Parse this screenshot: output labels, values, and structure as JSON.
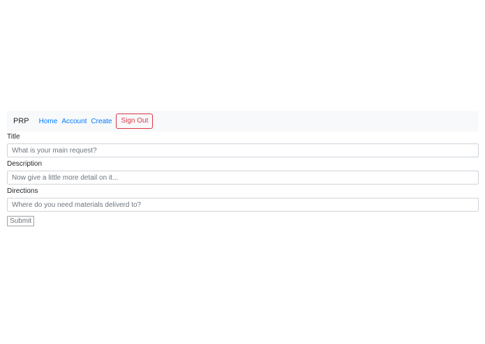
{
  "nav": {
    "brand": "PRP",
    "links": [
      "Home",
      "Account",
      "Create"
    ],
    "signout": "Sign Out"
  },
  "form": {
    "title_label": "Title",
    "title_placeholder": "What is your main request?",
    "description_label": "Description",
    "description_placeholder": "Now give a little more detail on it...",
    "directions_label": "Directions",
    "directions_placeholder": "Where do you need materials deliverd to?",
    "submit_label": "Submit"
  },
  "colors": {
    "link": "#007bff",
    "danger": "#dc3545",
    "navbar_bg": "#f8f9fa"
  }
}
